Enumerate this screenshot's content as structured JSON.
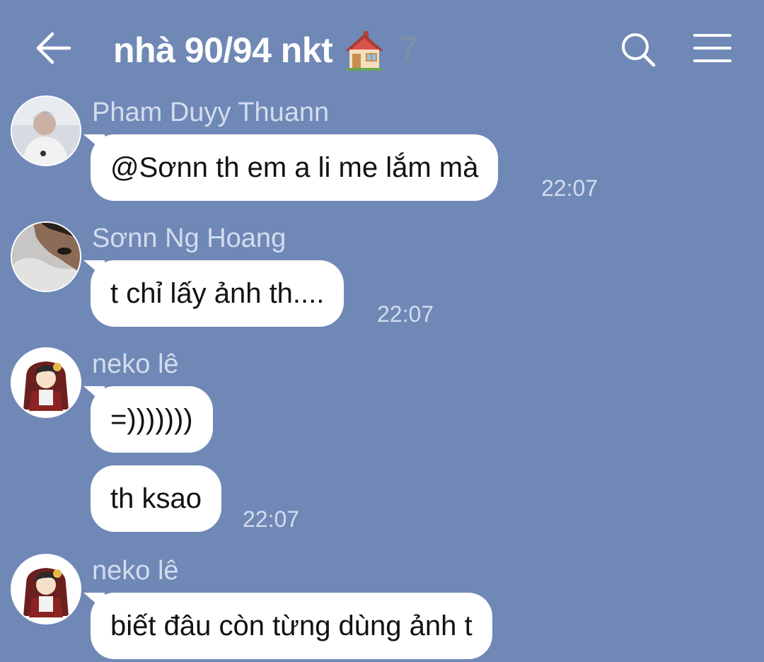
{
  "header": {
    "back_icon": "arrow-left-icon",
    "title": "nhà 90/94 nkt",
    "title_emoji_icon": "house-with-garden-icon",
    "member_count": "7",
    "search_icon": "search-icon",
    "menu_icon": "hamburger-menu-icon"
  },
  "messages": [
    {
      "sender": "Pham Duyy Thuann",
      "text": "@Sơnn th em a li me lắm mà",
      "time": "22:07"
    },
    {
      "sender": "Sơnn Ng Hoang",
      "text": "t chỉ lấy ảnh th....",
      "time": "22:07"
    },
    {
      "sender": "neko lê",
      "text": "=)))))))",
      "time": ""
    },
    {
      "sender": "",
      "text": "th ksao",
      "time": "22:07"
    },
    {
      "sender": "neko lê",
      "text": "biết đâu còn từng dùng ảnh t",
      "time": ""
    }
  ],
  "colors": {
    "background": "#6f88b6",
    "bubble": "#ffffff",
    "meta_text": "#d3dcee"
  }
}
